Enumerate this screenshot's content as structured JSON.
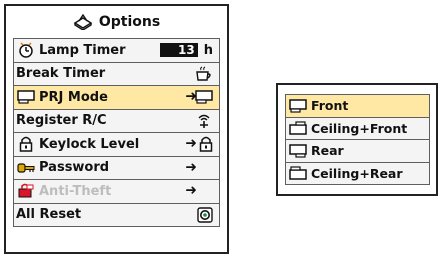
{
  "options_menu": {
    "title": "Options",
    "items": [
      {
        "label": "Lamp Timer",
        "value": "13",
        "unit": "h"
      },
      {
        "label": "Break Timer"
      },
      {
        "label": "PRJ Mode",
        "arrow": "➜"
      },
      {
        "label": "Register R/C"
      },
      {
        "label": "Keylock Level",
        "arrow": "➜"
      },
      {
        "label": "Password",
        "arrow": "➜"
      },
      {
        "label": "Anti-Theft",
        "arrow": "➜"
      },
      {
        "label": "All Reset"
      }
    ],
    "selected_item": "PRJ Mode",
    "disabled_item": "Anti-Theft"
  },
  "prj_mode_submenu": {
    "items": [
      {
        "label": "Front"
      },
      {
        "label": "Ceiling+Front"
      },
      {
        "label": "Rear"
      },
      {
        "label": "Ceiling+Rear"
      }
    ],
    "selected_item": "Front"
  },
  "colors": {
    "highlight": "#ffe8a3",
    "row_bg": "#f4f4f4",
    "border": "#222222",
    "disabled_text": "#bdbdbd"
  }
}
